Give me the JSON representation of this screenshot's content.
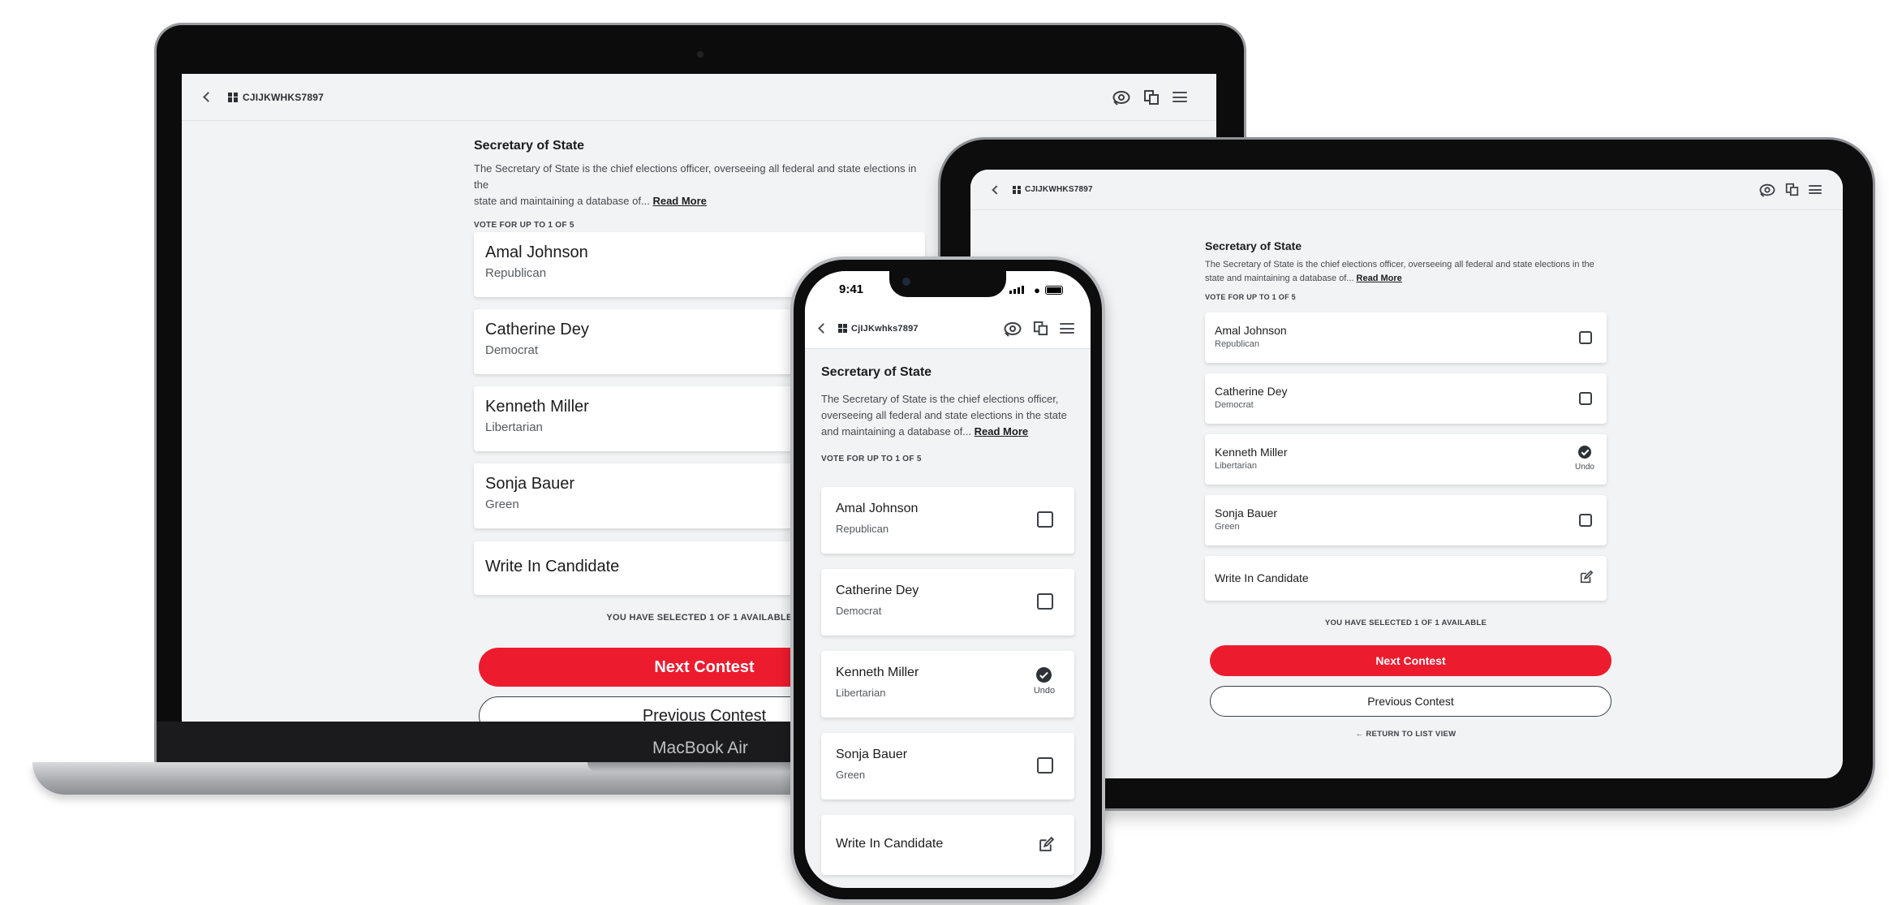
{
  "app": {
    "ballot_code_upper": "CJIJKWHKS7897",
    "ballot_code_phone": "CjIJKwhks7897"
  },
  "contest": {
    "title": "Secretary of State",
    "description_lines_wide": [
      "The Secretary of State is the chief elections officer, overseeing all federal and state elections in the",
      "state and maintaining a database of..."
    ],
    "description_lines_phone": [
      "The Secretary of State is the chief elections officer,",
      "overseeing all federal and state elections in the state",
      "and maintaining a database of..."
    ],
    "read_more": "Read More",
    "vote_for": "VOTE FOR UP TO 1 OF 5",
    "selected_note": "YOU HAVE SELECTED 1 OF 1 AVAILABLE"
  },
  "candidates": [
    {
      "name": "Amal Johnson",
      "party": "Republican",
      "selected": false
    },
    {
      "name": "Catherine Dey",
      "party": "Democrat",
      "selected": false
    },
    {
      "name": "Kenneth Miller",
      "party": "Libertarian",
      "selected": true
    },
    {
      "name": "Sonja Bauer",
      "party": "Green",
      "selected": false
    }
  ],
  "write_in": "Write In Candidate",
  "undo": "Undo",
  "buttons": {
    "next": "Next Contest",
    "previous": "Previous Contest",
    "return": "RETURN TO LIST VIEW"
  },
  "phone_status": {
    "time": "9:41"
  },
  "laptop_brand": "MacBook Air",
  "colors": {
    "accent": "#ed1b2e",
    "background": "#f2f3f4",
    "card": "#ffffff"
  },
  "icons": [
    "back-chevron-icon",
    "qr-code-icon",
    "audio-icon",
    "translate-icon",
    "menu-icon",
    "checkbox-icon",
    "check-circle-icon",
    "edit-icon",
    "arrow-left-icon"
  ]
}
